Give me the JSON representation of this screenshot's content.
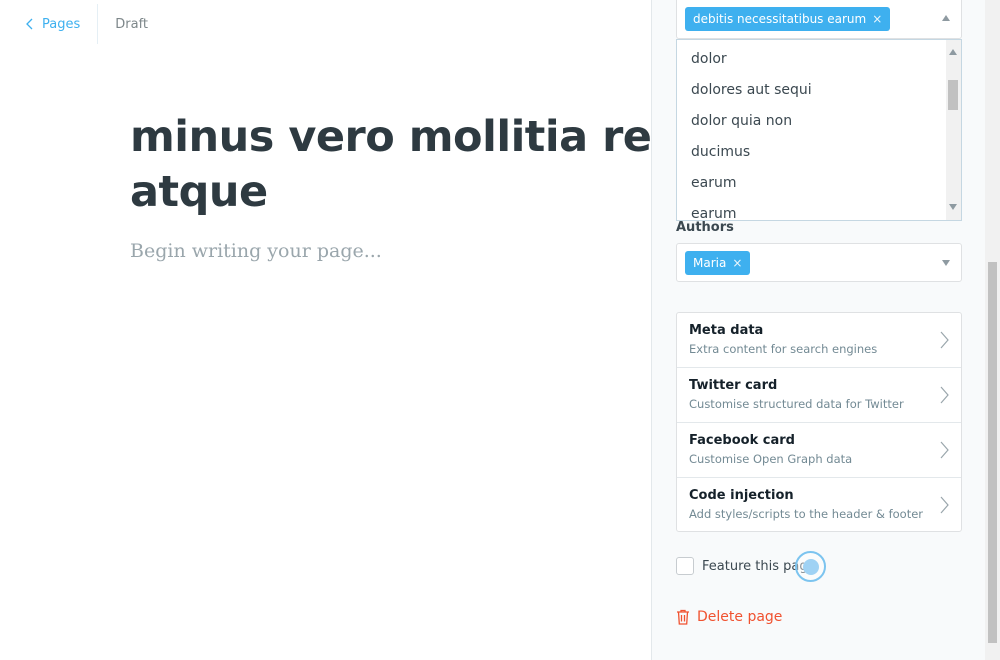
{
  "breadcrumb": {
    "back_label": "Pages",
    "status": "Draft"
  },
  "editor": {
    "title": "minus vero mollitia rep atque",
    "body_placeholder": "Begin writing your page..."
  },
  "settings": {
    "tags": {
      "selected": [
        {
          "label": "debitis necessitatibus earum",
          "remove": "×"
        }
      ],
      "options": [
        "dolor",
        "dolores aut sequi",
        "dolor quia non",
        "ducimus",
        "earum",
        "earum"
      ]
    },
    "authors": {
      "label": "Authors",
      "selected": [
        {
          "label": "Maria",
          "remove": "×"
        }
      ]
    },
    "nav": [
      {
        "title": "Meta data",
        "desc": "Extra content for search engines"
      },
      {
        "title": "Twitter card",
        "desc": "Customise structured data for Twitter"
      },
      {
        "title": "Facebook card",
        "desc": "Customise Open Graph data"
      },
      {
        "title": "Code injection",
        "desc": "Add styles/scripts to the header & footer"
      }
    ],
    "feature_label": "Feature this page",
    "delete_label": "Delete page"
  },
  "colors": {
    "accent": "#3eb0ef",
    "danger": "#f05230",
    "text": "#2e3a41"
  },
  "icons": [
    "chevron-left-icon",
    "caret-up-icon",
    "caret-down-icon",
    "remove-icon",
    "chevron-right-icon",
    "trash-icon"
  ]
}
